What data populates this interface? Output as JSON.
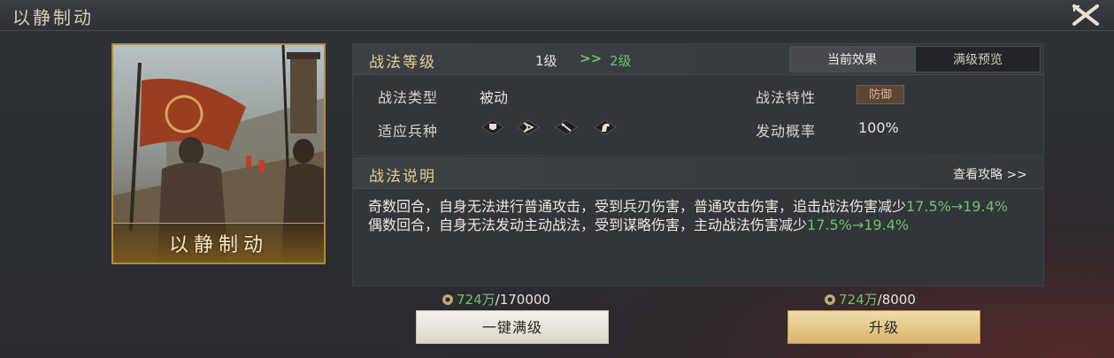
{
  "window": {
    "title": "以静制动"
  },
  "card": {
    "name": "以静制动"
  },
  "header": {
    "label": "战法等级",
    "level_current": "1级",
    "level_arrow": ">>",
    "level_next": "2级",
    "tabs": [
      {
        "label": "当前效果",
        "active": true
      },
      {
        "label": "满级预览",
        "active": false
      }
    ]
  },
  "attributes": {
    "type_label": "战法类型",
    "type_value": "被动",
    "trait_label": "战法特性",
    "trait_value": "防御",
    "units_label": "适应兵种",
    "units_icons": [
      "shield-icon",
      "bow-icon",
      "spear-icon",
      "horse-icon"
    ],
    "chance_label": "发动概率",
    "chance_value": "100%"
  },
  "description": {
    "label": "战法说明",
    "guide_link": "查看攻略 >>",
    "line1_text": "奇数回合，自身无法进行普通攻击，受到兵刃伤害，普通攻击伤害，追击战法伤害减少",
    "line1_value": "17.5%→19.4%",
    "line2_text": "偶数回合，自身无法发动主动战法，受到谋略伤害，主动战法伤害减少",
    "line2_value": "17.5%→19.4%"
  },
  "costs": {
    "max": {
      "have": "724万",
      "need": "/170000"
    },
    "upgrade": {
      "have": "724万",
      "need": "/8000"
    }
  },
  "buttons": {
    "max_level": "一键满级",
    "upgrade": "升级"
  },
  "colors": {
    "highlight_green": "#6fc26a",
    "gold_title": "#e6cf92",
    "upgrade_button": "#d9b46d"
  }
}
